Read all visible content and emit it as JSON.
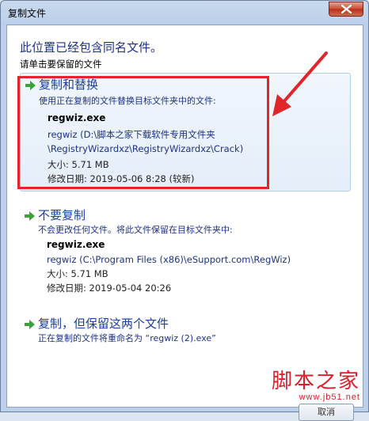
{
  "window": {
    "title": "复制文件"
  },
  "dialog": {
    "heading": "此位置已经包含同名文件。",
    "subheading": "请单击要保留的文件"
  },
  "options": [
    {
      "title": "复制和替换",
      "description": "使用正在复制的文件替换目标文件夹中的文件:",
      "file_name": "regwiz.exe",
      "path_line1": "regwiz (D:\\脚本之家下载软件专用文件夹",
      "path_line2": "\\RegistryWizardxz\\RegistryWizardxz\\Crack)",
      "size": "大小: 5.71 MB",
      "modified": "修改日期: 2019-05-06 8:28 (较新)"
    },
    {
      "title": "不要复制",
      "description": "不会更改任何文件。将此文件保留在目标文件夹中:",
      "file_name": "regwiz.exe",
      "path_line1": "regwiz (C:\\Program Files (x86)\\eSupport.com\\RegWiz)",
      "size": "大小: 5.71 MB",
      "modified": "修改日期: 2019-05-04 20:26"
    },
    {
      "title": "复制，但保留这两个文件",
      "description": "正在复制的文件将重命名为 “regwiz (2).exe”"
    }
  ],
  "footer": {
    "cancel_label": "取消"
  },
  "watermark": {
    "main": "脚本之家",
    "sub": "www.jb51.net"
  },
  "colors": {
    "accent": "#1a3fa3",
    "highlight": "#e0262a",
    "arrow": "#3aa23a"
  },
  "icons": {
    "close": "close-icon",
    "option_arrow": "green-arrow-icon"
  }
}
